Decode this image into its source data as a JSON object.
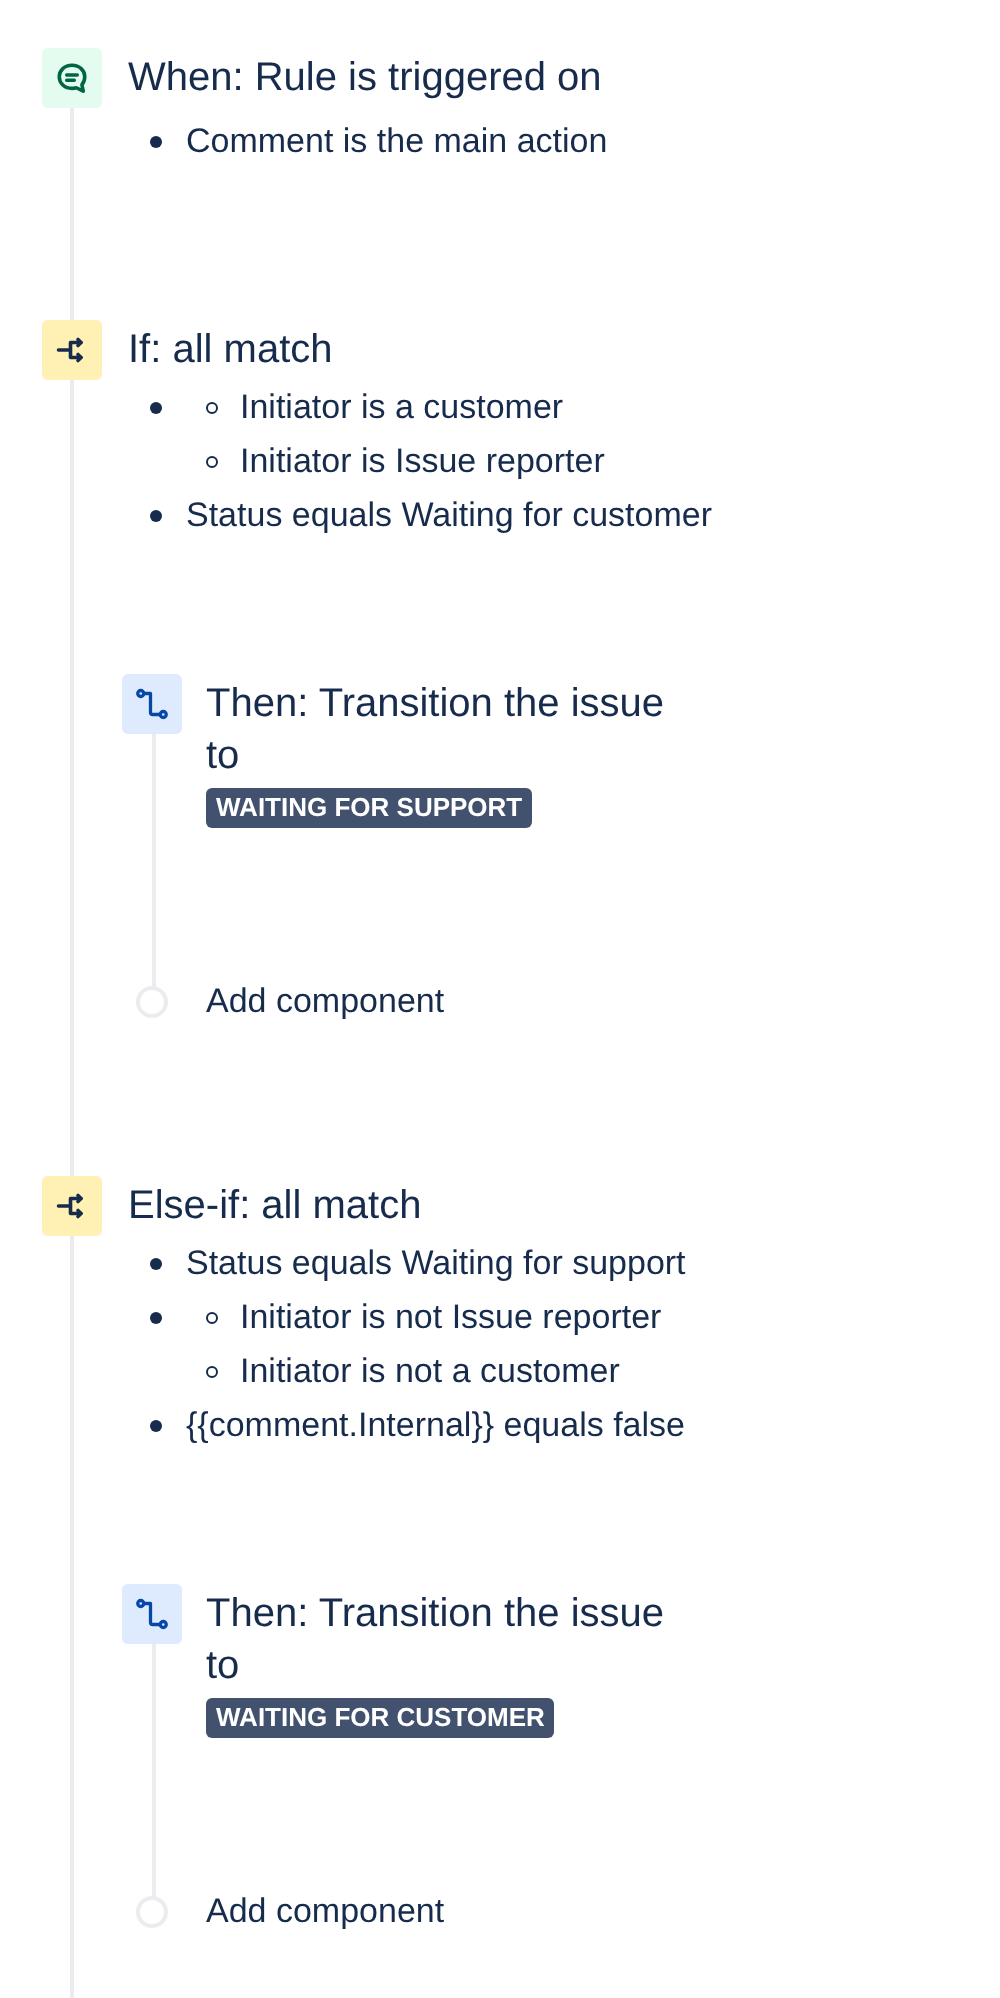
{
  "components": [
    {
      "kind": "trigger",
      "title": "When: Rule is triggered on",
      "items": [
        {
          "text": "Comment is the main action"
        }
      ]
    },
    {
      "kind": "condition",
      "title": "If: all match",
      "items": [
        {
          "children": [
            {
              "text": "Initiator is a customer"
            },
            {
              "text": "Initiator is Issue reporter"
            }
          ]
        },
        {
          "text": "Status equals Waiting for customer"
        }
      ],
      "branch": [
        {
          "kind": "action",
          "title": "Then: Transition the issue to",
          "status": "WAITING FOR SUPPORT"
        },
        {
          "kind": "add",
          "label": "Add component"
        }
      ]
    },
    {
      "kind": "condition",
      "title": "Else-if: all match",
      "items": [
        {
          "text": "Status equals Waiting for support"
        },
        {
          "children": [
            {
              "text": "Initiator is not Issue reporter"
            },
            {
              "text": "Initiator is not a customer"
            }
          ]
        },
        {
          "text": "{{comment.Internal}} equals false"
        }
      ],
      "branch": [
        {
          "kind": "action",
          "title": "Then: Transition the issue to",
          "status": "WAITING FOR CUSTOMER"
        },
        {
          "kind": "add",
          "label": "Add component"
        }
      ]
    }
  ]
}
